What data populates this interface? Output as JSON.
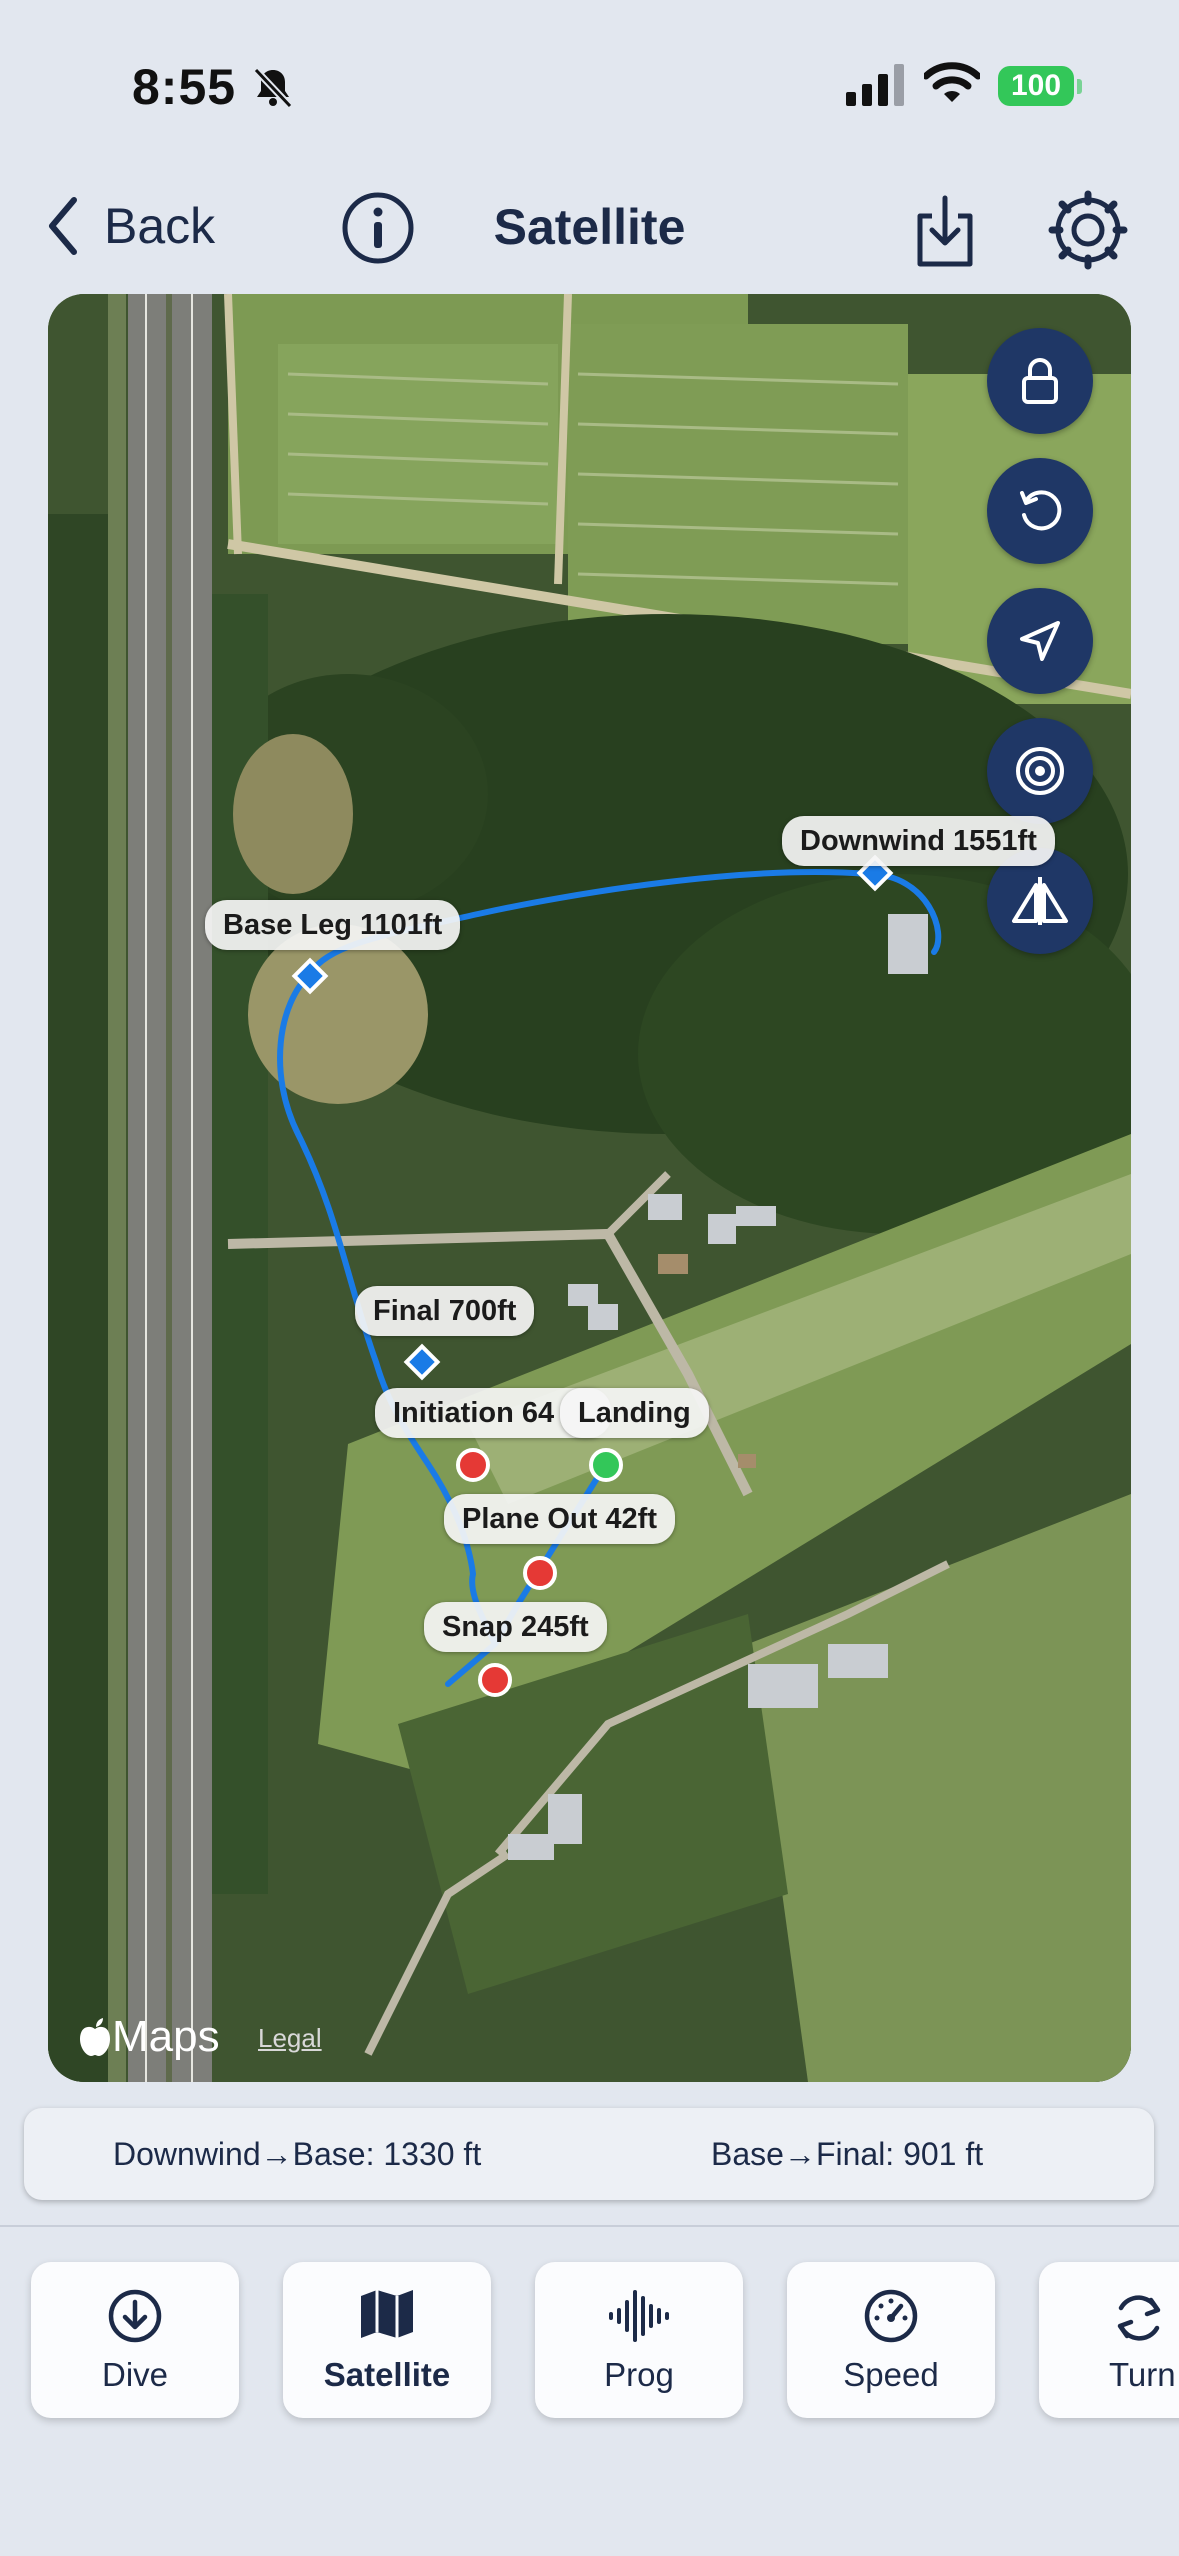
{
  "status_bar": {
    "time": "8:55",
    "battery": "100"
  },
  "nav": {
    "back_label": "Back",
    "title": "Satellite"
  },
  "map": {
    "attribution": "Maps",
    "legal": "Legal",
    "labels": {
      "downwind": "Downwind 1551ft",
      "base_leg": "Base Leg 1101ft",
      "final": "Final 700ft",
      "initiation": "Initiation 64",
      "landing": "Landing",
      "plane_out": "Plane Out 42ft",
      "snap": "Snap 245ft"
    },
    "colors": {
      "path": "#1a7be6",
      "red_marker": "#e53935",
      "green_marker": "#33c759",
      "fab": "#1f3766"
    },
    "fab_icons": [
      "lock-icon",
      "rotate-icon",
      "location-arrow-icon",
      "target-icon",
      "compare-icon"
    ]
  },
  "stats": {
    "downwind_to_base": "Downwind→Base: 1330 ft",
    "base_to_final": "Base→Final: 901 ft"
  },
  "tabs": [
    {
      "label": "Dive",
      "icon": "arrow-down-circle-icon"
    },
    {
      "label": "Satellite",
      "icon": "map-icon",
      "active": true
    },
    {
      "label": "Prog",
      "icon": "waveform-icon"
    },
    {
      "label": "Speed",
      "icon": "speedometer-icon"
    },
    {
      "label": "Turn",
      "icon": "rotate-arrows-icon"
    }
  ]
}
